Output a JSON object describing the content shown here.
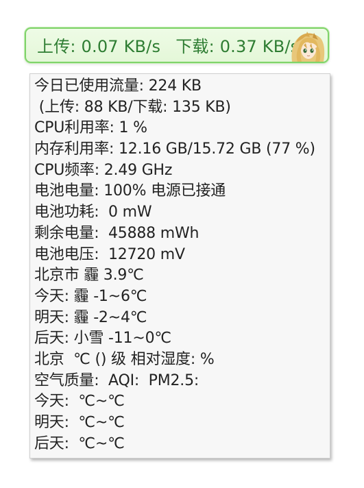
{
  "speed_bar": {
    "upload": "上传: 0.07 KB/s",
    "download": "下载: 0.37 KB/s",
    "text_color": "#2e7d32",
    "border_color": "#7fd36a",
    "background_color": "#e8f9dd",
    "mascot_icon": "anime-girl-mascot-icon"
  },
  "info": {
    "lines": [
      "今日已使用流量: 224 KB",
      " (上传: 88 KB/下载: 135 KB)",
      "CPU利用率: 1 %",
      "内存利用率: 12.16 GB/15.72 GB (77 %)",
      "CPU频率: 2.49 GHz",
      "电池电量: 100% 电源已接通",
      "电池功耗:  0 mW",
      "剩余电量:  45888 mWh",
      "电池电压:  12720 mV",
      "北京市 霾 3.9℃",
      "今天: 霾 -1~6℃",
      "明天: 霾 -2~4℃",
      "后天: 小雪 -11~0℃",
      "北京  ℃ () 级 相对湿度: %",
      "空气质量:  AQI:  PM2.5: ",
      "今天:  ℃~℃",
      "明天:  ℃~℃",
      "后天:  ℃~℃"
    ]
  }
}
